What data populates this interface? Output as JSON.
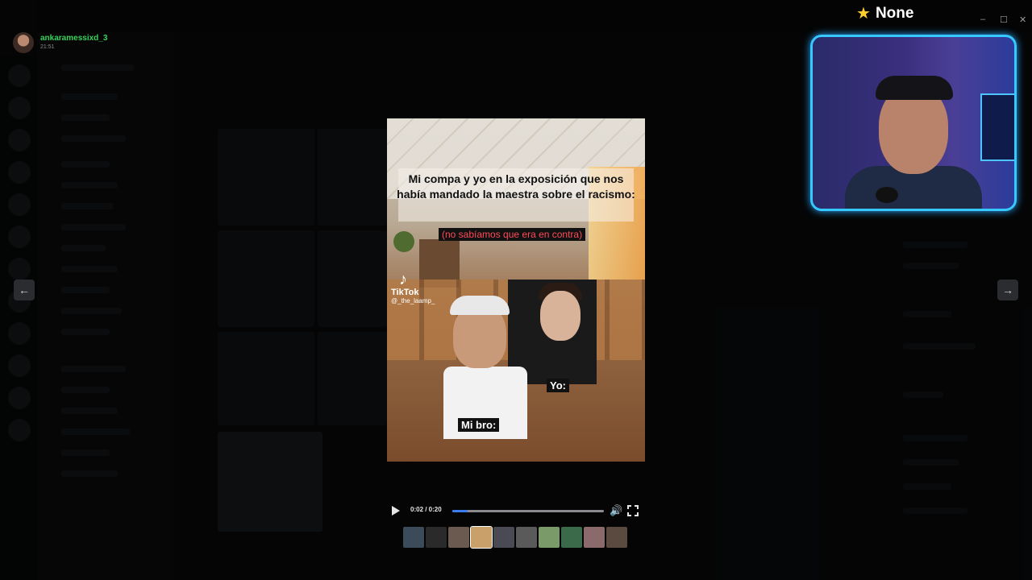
{
  "uploader": {
    "name": "ankaramessixd_3",
    "time": "21:51"
  },
  "webcam": {
    "title": "None",
    "star_icon": "star-icon"
  },
  "video": {
    "caption": "Mi compa y yo en la exposición que nos había mandado la maestra sobre el racismo:",
    "subnote": "(no sabíamos que era en contra)",
    "watermark_name": "TikTok",
    "watermark_handle": "@_the_laamp_",
    "label_right": "Yo:",
    "label_left": "Mi bro:"
  },
  "controls": {
    "time": "0:02 / 0:20",
    "progress": 0.1
  },
  "thumbnail_colors": [
    "#3c4b5a",
    "#2a2a2a",
    "#6a5a50",
    "#c9a06a",
    "#4a4a55",
    "#5a5a5a",
    "#7b9a6a",
    "#3b6a4a",
    "#8a6a6a",
    "#5a4a40"
  ],
  "colors": {
    "accent": "#3a7df0",
    "uploader": "#37d35a",
    "cam_border": "#36c9ff"
  }
}
